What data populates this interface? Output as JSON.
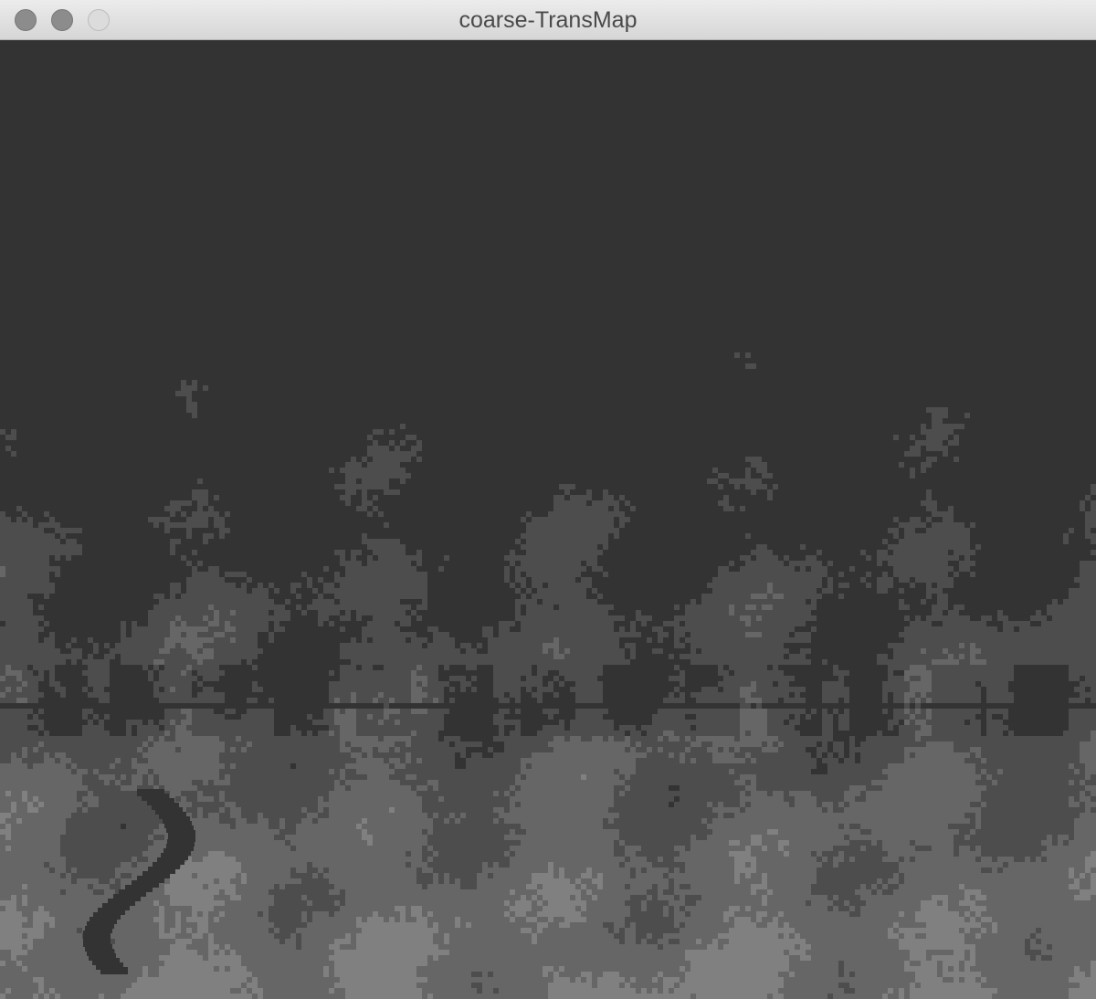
{
  "window": {
    "title": "coarse-TransMap"
  },
  "icons": {
    "close": "close-button-circle",
    "minimize": "minimize-button-circle",
    "zoom": "zoom-button-circle"
  },
  "transmission_map": {
    "description_levels": [
      "#333333",
      "#4d4d4d",
      "#666666",
      "#808080"
    ],
    "style": "coarse blocky grayscale transmission map"
  }
}
